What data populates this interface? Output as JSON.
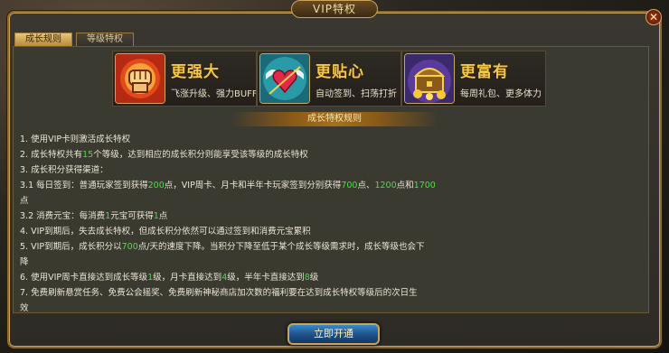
{
  "dialog": {
    "title": "VIP特权",
    "close_label": "✕"
  },
  "tabs": [
    {
      "label": "成长规则",
      "active": true
    },
    {
      "label": "等级特权",
      "active": false
    }
  ],
  "features": [
    {
      "title": "更强大",
      "desc": "飞涨升级、强力BUFF",
      "icon": "fist-icon"
    },
    {
      "title": "更贴心",
      "desc": "自动签到、扫荡打折",
      "icon": "winged-heart-icon"
    },
    {
      "title": "更富有",
      "desc": "每周礼包、更多体力",
      "icon": "treasure-chest-icon"
    }
  ],
  "section_title": "成长特权规则",
  "rules": [
    {
      "parts": [
        "1.  使用VIP卡则激活成长特权"
      ]
    },
    {
      "parts": [
        "2.  成长特权共有",
        "15",
        "个等级，达到相应的成长积分则能享受该等级的成长特权"
      ]
    },
    {
      "parts": [
        "3.  成长积分获得渠道："
      ]
    },
    {
      "parts": [
        "3.1  每日签到：普通玩家签到获得",
        "200",
        "点，VIP周卡、月卡和半年卡玩家签到分别获得",
        "700",
        "点、",
        "1200",
        "点和",
        "1700"
      ]
    },
    {
      "parts": [
        "点"
      ]
    },
    {
      "parts": [
        "3.2  消费元宝：每消费",
        "1",
        "元宝可获得",
        "1",
        "点"
      ]
    },
    {
      "parts": [
        "4.  VIP到期后，失去成长特权，但成长积分依然可以通过签到和消费元宝累积"
      ]
    },
    {
      "parts": [
        "5.  VIP到期后，成长积分以",
        "700",
        "点/天的速度下降。当积分下降至低于某个成长等级需求时，成长等级也会下"
      ]
    },
    {
      "parts": [
        "降"
      ]
    },
    {
      "parts": [
        "6.  使用VIP周卡直接达到成长等级",
        "1",
        "级，月卡直接达到",
        "4",
        "级，半年卡直接达到",
        "8",
        "级"
      ]
    },
    {
      "parts": [
        "7.  免费刷新悬赏任务、免费公会摇奖、免费刷新神秘商店加次数的福利要在达到成长特权等级后的次日生"
      ]
    },
    {
      "parts": [
        "效"
      ]
    }
  ],
  "cta_label": "立即开通",
  "colors": {
    "highlight": "#46e046",
    "feature_title": "#f2c84a",
    "gold_border": "#c9a45a"
  }
}
